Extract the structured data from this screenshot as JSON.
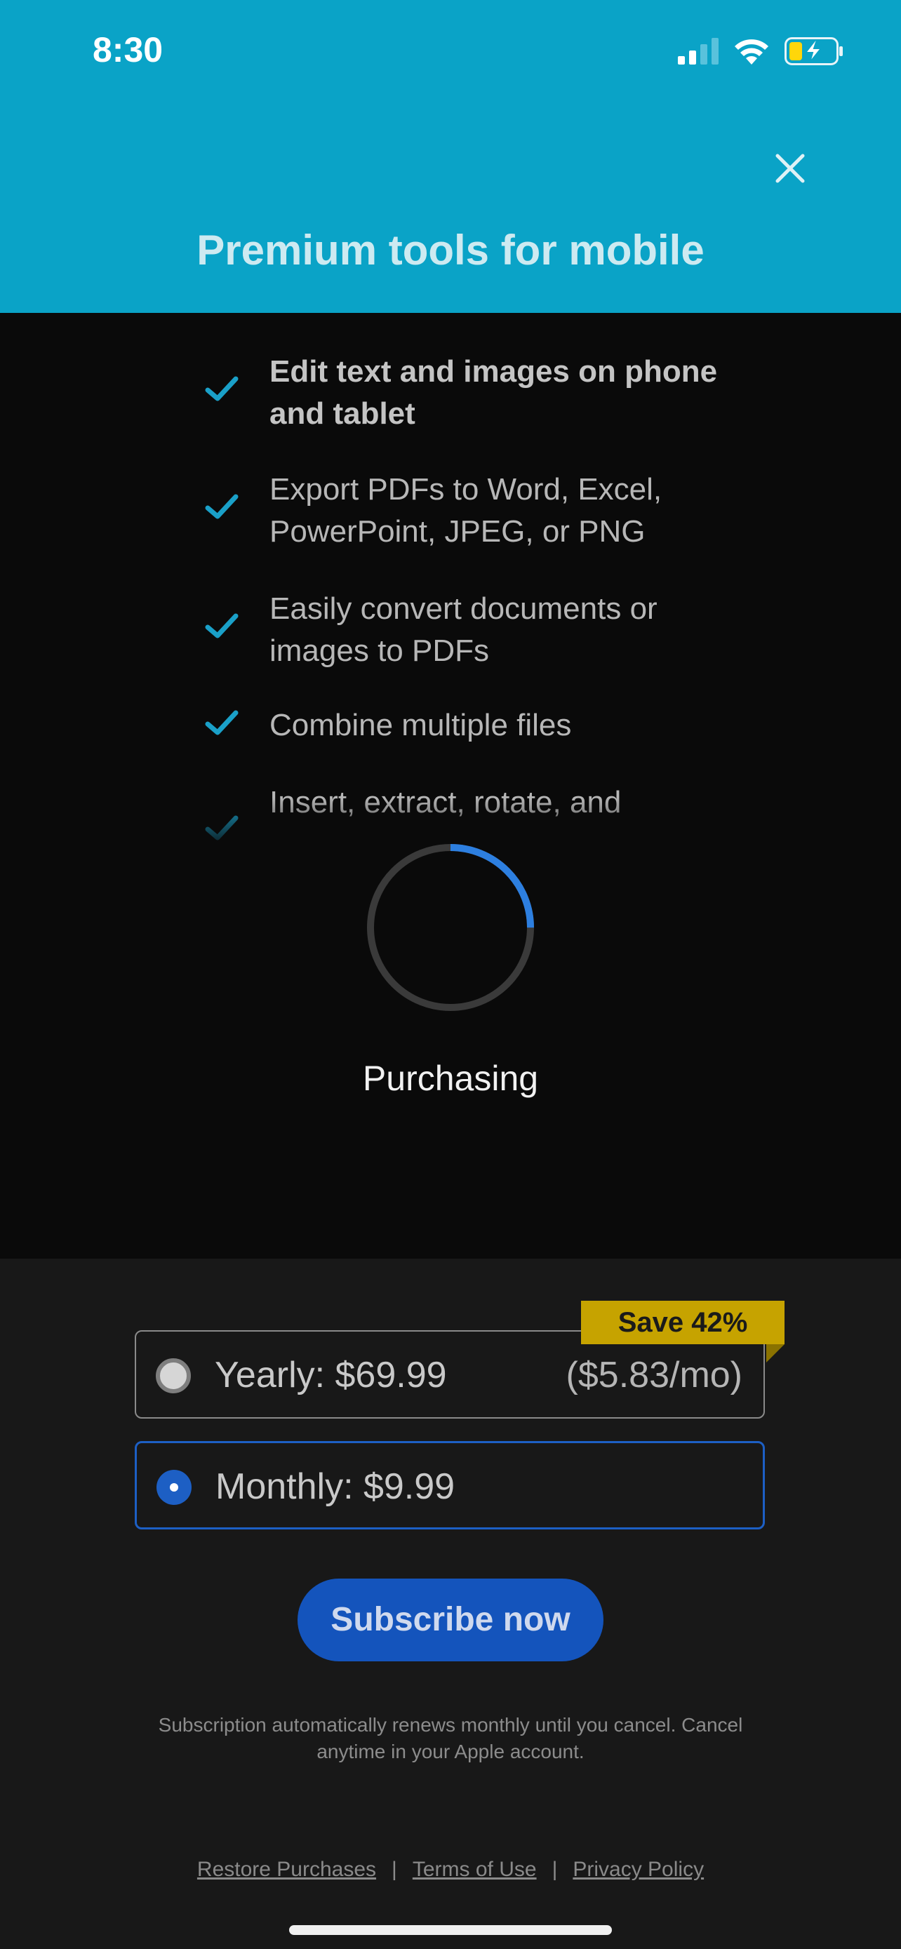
{
  "status_bar": {
    "time": "8:30"
  },
  "header": {
    "title": "Premium tools for mobile"
  },
  "features": [
    {
      "text": "Edit text and images on phone and tablet",
      "bold": true
    },
    {
      "text": "Export PDFs to Word, Excel, PowerPoint, JPEG, or PNG",
      "bold": false
    },
    {
      "text": "Easily convert documents or images to PDFs",
      "bold": false
    },
    {
      "text": "Combine multiple files",
      "bold": false
    },
    {
      "text": "Insert, extract, rotate, and",
      "bold": false
    }
  ],
  "loader": {
    "label": "Purchasing",
    "progress": 0.25
  },
  "plans": {
    "yearly": {
      "label": "Yearly: $69.99",
      "per_month": "($5.83/mo)",
      "badge": "Save 42%",
      "selected": false
    },
    "monthly": {
      "label": "Monthly: $9.99",
      "selected": true
    }
  },
  "subscribe_label": "Subscribe now",
  "disclaimer": "Subscription automatically renews monthly until you cancel. Cancel anytime in your Apple account.",
  "footer_links": {
    "restore": "Restore Purchases",
    "terms": "Terms of Use",
    "privacy": "Privacy Policy",
    "separator": "|"
  },
  "colors": {
    "header_bg": "#0aa3c7",
    "accent_blue": "#1d5fc4",
    "badge_gold": "#c6a300",
    "check_teal": "#1aa0c8"
  },
  "icons": [
    "signal-icon",
    "wifi-icon",
    "battery-charging-icon",
    "close-icon",
    "checkmark-icon",
    "spinner-icon"
  ]
}
